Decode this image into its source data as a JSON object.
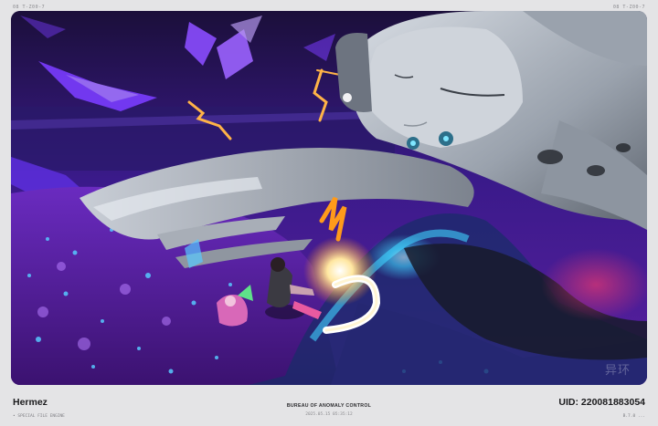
{
  "corner_marks": {
    "top_left": "08  T-Z00-7",
    "top_right": "08  T-Z00-7"
  },
  "footer": {
    "player_name": "Hermez",
    "file_label": "• SPECIAL FILE ENGINE",
    "organization": "BUREAU OF ANOMALY CONTROL",
    "timestamp": "2025.05.15 05:35:12",
    "uid": "UID: 220081883054",
    "version": "B.7.0 ..."
  },
  "watermark": "异环",
  "colors": {
    "frame": "#e4e4e6",
    "sky_purple": "#3a1a8a",
    "foliage_purple": "#7a2fd0",
    "cyan_glow": "#3fd4ff",
    "orange_flame": "#ff9a1a",
    "statue_gray": "#b8bec6"
  },
  "icons": [
    "character-sprite-icon",
    "companion-sprite-icon",
    "slash-effect-icon"
  ]
}
